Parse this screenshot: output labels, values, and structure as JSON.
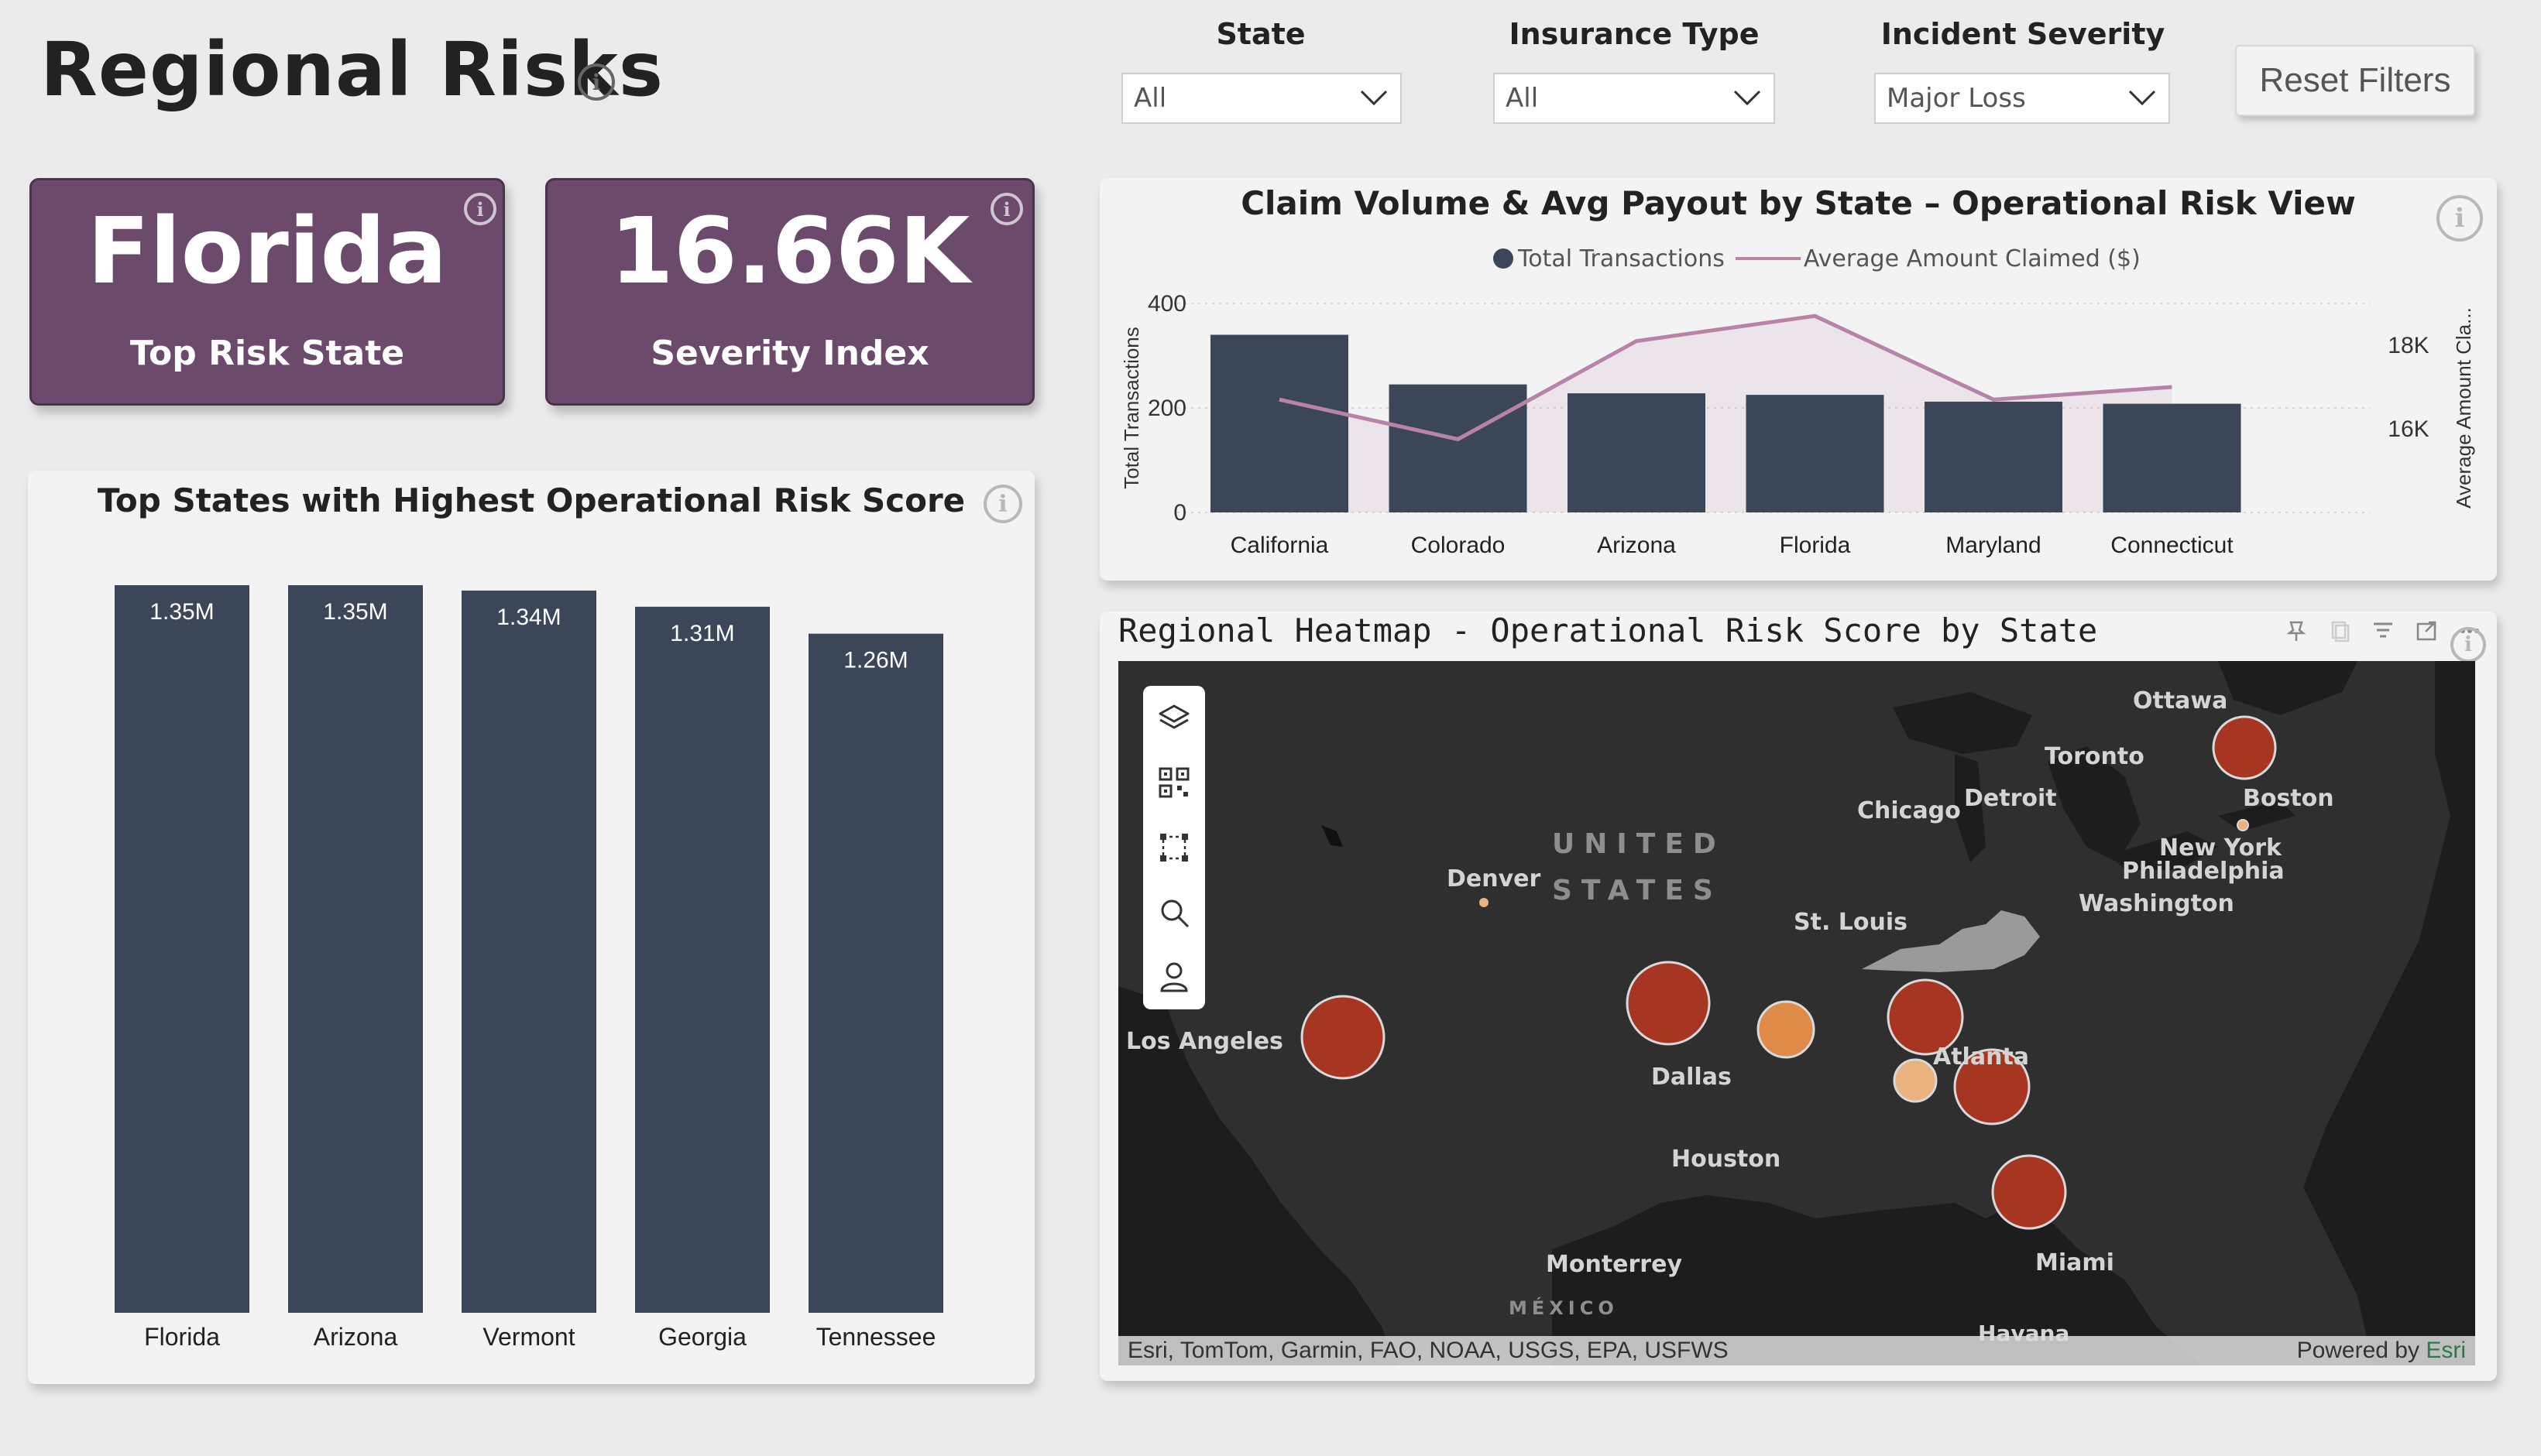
{
  "header": {
    "title": "Regional Risks"
  },
  "filters": [
    {
      "label": "State",
      "value": "All"
    },
    {
      "label": "Insurance Type",
      "value": "All"
    },
    {
      "label": "Incident Severity",
      "value": "Major Loss"
    }
  ],
  "reset_label": "Reset Filters",
  "kpis": [
    {
      "value": "Florida",
      "label": "Top Risk State"
    },
    {
      "value": "16.66K",
      "label": "Severity Index"
    }
  ],
  "colors": {
    "accent_purple": "#6b4a6b",
    "bar_dark": "#3b4758",
    "line_pink": "#b784a7",
    "map_bg": "#2b2b2b",
    "bubble_red": "#a63621",
    "bubble_orange": "#e08a4a",
    "bubble_light": "#e9b27e"
  },
  "top_states_chart": {
    "title": "Top States with Highest Operational Risk Score",
    "chart_data": {
      "type": "bar",
      "categories": [
        "Florida",
        "Arizona",
        "Vermont",
        "Georgia",
        "Tennessee"
      ],
      "values": [
        1350000,
        1350000,
        1340000,
        1310000,
        1260000
      ],
      "data_labels": [
        "1.35M",
        "1.35M",
        "1.34M",
        "1.31M",
        "1.26M"
      ],
      "ylim": [
        0,
        1350000
      ]
    }
  },
  "claims_chart": {
    "title": "Claim Volume & Avg Payout by State – Operational Risk View",
    "legend": [
      "Total Transactions",
      "Average Amount Claimed ($)"
    ],
    "ylabel_left": "Total Transactions",
    "ylabel_right": "Average Amount Cla...",
    "left_ticks": [
      "400",
      "200",
      "0"
    ],
    "right_ticks": [
      "18K",
      "16K"
    ],
    "chart_data": {
      "type": "bar",
      "categories": [
        "California",
        "Colorado",
        "Arizona",
        "Florida",
        "Maryland",
        "Connecticut"
      ],
      "series": [
        {
          "name": "Total Transactions",
          "type": "bar",
          "values": [
            340,
            245,
            228,
            225,
            212,
            208
          ]
        },
        {
          "name": "Average Amount Claimed ($)",
          "type": "line",
          "values": [
            16700,
            15750,
            18100,
            18700,
            16700,
            17000
          ]
        }
      ],
      "ylim_left": [
        0,
        400
      ],
      "ylim_right": [
        14000,
        19000
      ]
    }
  },
  "map": {
    "title": "Regional Heatmap - Operational Risk Score by State",
    "tools": [
      "layers-icon",
      "qr-select-icon",
      "rect-select-icon",
      "search-icon",
      "person-icon"
    ],
    "labels": [
      "Ottawa",
      "Toronto",
      "Detroit",
      "Chicago",
      "Boston",
      "New York",
      "Philadelphia",
      "Washington",
      "Denver",
      "UNITED",
      "STATES",
      "St. Louis",
      "Los Angeles",
      "Dallas",
      "Atlanta",
      "Houston",
      "Miami",
      "Monterrey",
      "MÉXICO",
      "Havana"
    ],
    "attribution": "Esri, TomTom, Garmin, FAO, NOAA, USGS, EPA, USFWS",
    "powered_prefix": "Powered by ",
    "powered_brand": "Esri"
  }
}
